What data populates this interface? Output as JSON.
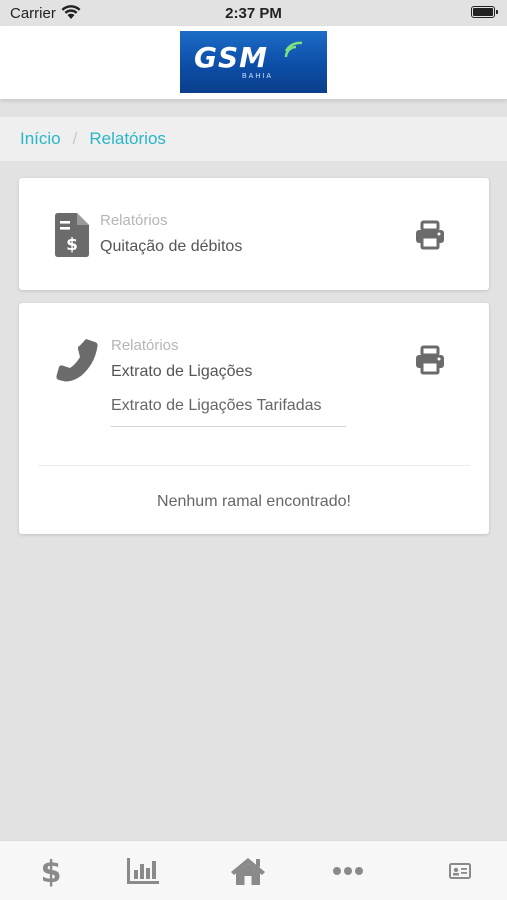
{
  "status_bar": {
    "carrier": "Carrier",
    "time": "2:37 PM"
  },
  "header": {
    "logo_text": "GSM",
    "logo_subtext": "BAHIA"
  },
  "breadcrumb": {
    "home": "Início",
    "separator": "/",
    "current": "Relatórios"
  },
  "cards": [
    {
      "category": "Relatórios",
      "title": "Quitação de débitos",
      "icon": "invoice-dollar-icon",
      "action_icon": "print-icon"
    },
    {
      "category": "Relatórios",
      "title": "Extrato de Ligações",
      "icon": "phone-icon",
      "action_icon": "print-icon",
      "select_value": "Extrato de Ligações Tarifadas",
      "empty_message": "Nenhum ramal encontrado!"
    }
  ],
  "tab_bar": {
    "items": [
      {
        "icon": "dollar-icon"
      },
      {
        "icon": "bar-chart-icon"
      },
      {
        "icon": "home-icon"
      },
      {
        "icon": "more-icon"
      },
      {
        "icon": "id-card-icon"
      }
    ]
  },
  "colors": {
    "accent": "#29b6c9",
    "icon_gray": "#6b6b6b",
    "background": "#e2e2e2",
    "logo_blue": "#0d4ea8"
  }
}
